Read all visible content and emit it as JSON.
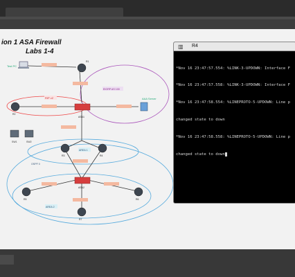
{
  "diagram": {
    "title_line1": "ion 1 ASA Firewall",
    "title_line2": "Labs 1-4",
    "labels": {
      "r1": "R1",
      "r2": "R2",
      "r3": "R3",
      "r4": "R4",
      "r5": "R5",
      "r6": "R6",
      "r7": "R7",
      "r8": "R8",
      "asa1": "ASA1",
      "asa2": "ASA2",
      "test_pc": "Test PC",
      "aaa_server": "AAA Server",
      "rip": "RIP v2",
      "eigrp": "EIGRP AS 100",
      "ospf0": "OSPF 0",
      "area0": "AREA 0",
      "area1": "AREA 1",
      "area2": "AREA 2",
      "sw1": "SW1",
      "sw2": "SW2"
    }
  },
  "terminal": {
    "title": "R4",
    "icon": "terminal-icon",
    "lines": [
      "*Nov 16 23:47:57.554: %LINK-3-UPDOWN: Interface F",
      "*Nov 16 23:47:57.558: %LINK-3-UPDOWN: Interface F",
      "*Nov 16 23:47:58.554: %LINEPROTO-5-UPDOWN: Line p",
      "changed state to down",
      "*Nov 16 23:47:58.558: %LINEPROTO-5-UPDOWN: Line p",
      "changed state to down"
    ]
  }
}
